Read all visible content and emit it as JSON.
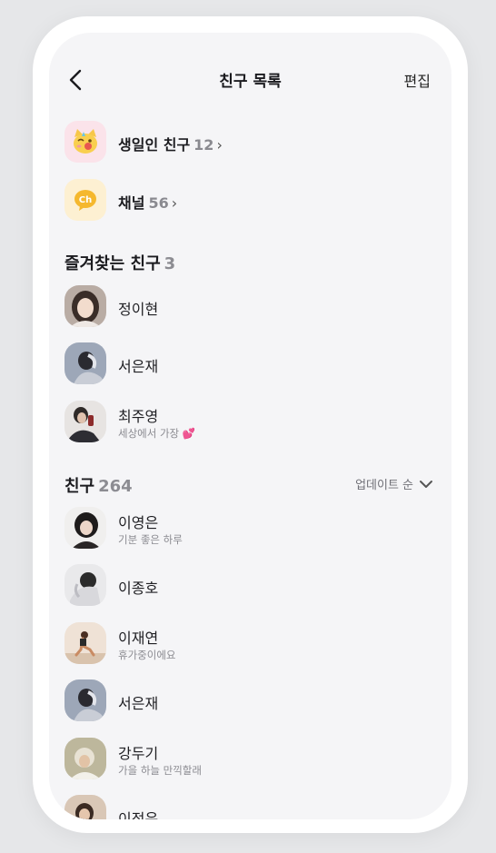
{
  "header": {
    "title": "친구 목록",
    "edit_label": "편집"
  },
  "shortcuts": [
    {
      "label": "생일인 친구",
      "count": "12",
      "icon": "birthday-cake-cat-icon",
      "bg": "#fbe3ea"
    },
    {
      "label": "채널",
      "count": "56",
      "icon": "channel-ch-icon",
      "bg": "#fdf0d2"
    }
  ],
  "favorites": {
    "title": "즐겨찾는 친구",
    "count": "3",
    "items": [
      {
        "name": "정이현",
        "status": "",
        "avatar": "avatar-1"
      },
      {
        "name": "서은재",
        "status": "",
        "avatar": "avatar-2"
      },
      {
        "name": "최주영",
        "status": "세상에서 가장 💕",
        "avatar": "avatar-3"
      }
    ]
  },
  "friends": {
    "title": "친구",
    "count": "264",
    "sort_label": "업데이트 순",
    "items": [
      {
        "name": "이영은",
        "status": "기분 좋은 하루",
        "avatar": "avatar-4"
      },
      {
        "name": "이종호",
        "status": "",
        "avatar": "avatar-5"
      },
      {
        "name": "이재연",
        "status": "휴가중이에요",
        "avatar": "avatar-6"
      },
      {
        "name": "서은재",
        "status": "",
        "avatar": "avatar-2"
      },
      {
        "name": "강두기",
        "status": "가을 하늘 만끽할래",
        "avatar": "avatar-7"
      },
      {
        "name": "이정은",
        "status": "",
        "avatar": "avatar-8"
      }
    ]
  },
  "colors": {
    "background": "#f5f5f7",
    "frame": "#ffffff",
    "muted": "#8a8a90"
  }
}
